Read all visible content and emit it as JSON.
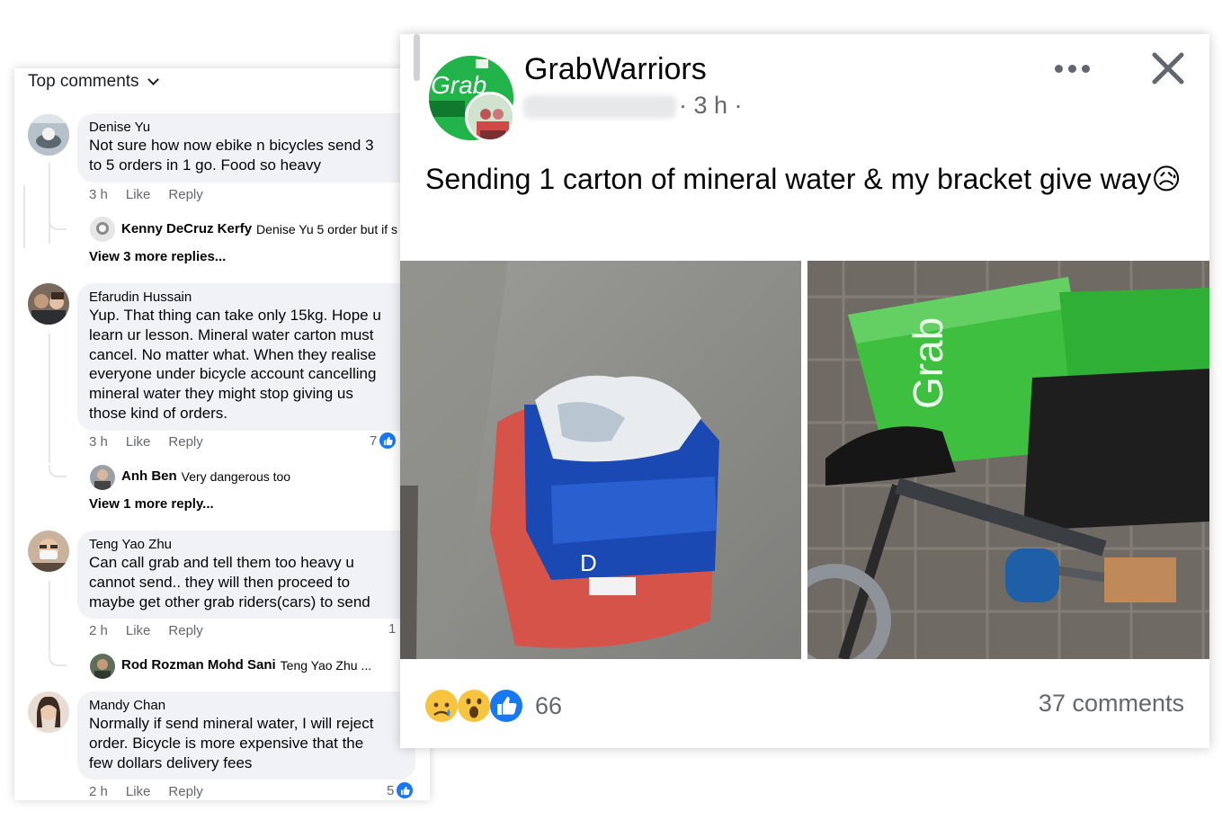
{
  "comments_panel": {
    "sort_label": "Top comments",
    "comments": [
      {
        "name": "Denise Yu",
        "text": "Not sure how now ebike n bicycles send 3\nto 5 orders in 1 go. Food so heavy",
        "time": "3 h",
        "like": "Like",
        "reply": "Reply",
        "reply_preview": {
          "name": "Kenny DeCruz Kerfy",
          "text": "Denise Yu 5 order but if s"
        },
        "view_more": "View 3 more replies..."
      },
      {
        "name": "Efarudin Hussain",
        "text": "Yup. That thing can take only 15kg. Hope u\nlearn ur lesson. Mineral water carton must\ncancel. No matter what. When they realise\neveryone under bicycle account cancelling\nmineral water they might stop giving us\nthose kind of orders.",
        "time": "3 h",
        "like": "Like",
        "reply": "Reply",
        "likes": "7",
        "reply_preview": {
          "name": "Anh Ben",
          "text": "Very dangerous too"
        },
        "view_more": "View 1 more reply..."
      },
      {
        "name": "Teng Yao Zhu",
        "text": "Can call grab and tell them too heavy u\ncannot send.. they will then proceed to\nmaybe get other grab riders(cars) to send",
        "time": "2 h",
        "like": "Like",
        "reply": "Reply",
        "likes": "1",
        "reply_preview": {
          "name": "Rod Rozman Mohd Sani",
          "text": "Teng Yao Zhu ..."
        }
      },
      {
        "name": "Mandy Chan",
        "text": "Normally if send mineral water, I will reject\norder. Bicycle is more expensive that the\nfew dollars delivery fees",
        "time": "2 h",
        "like": "Like",
        "reply": "Reply",
        "likes": "5"
      }
    ]
  },
  "post": {
    "group_name": "GrabWarriors",
    "meta": "· 3 h ·",
    "text": "Sending 1 carton of mineral water & my bracket give way😥",
    "reaction_count": "66",
    "comments_count": "37 comments",
    "logo_text": "Grab",
    "bag_text": "Grab",
    "icons": [
      "more-icon",
      "close-icon",
      "sad-reaction-icon",
      "wow-reaction-icon",
      "like-reaction-icon"
    ]
  },
  "colors": {
    "facebook_blue": "#1877f2",
    "grab_green": "#22b34a",
    "bubble_gray": "#f0f2f5",
    "meta_gray": "#65676b"
  }
}
